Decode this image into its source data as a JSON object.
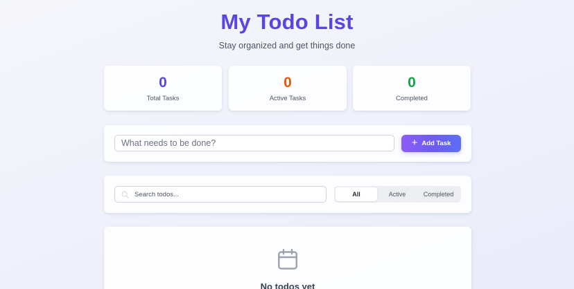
{
  "header": {
    "title": "My Todo List",
    "subtitle": "Stay organized and get things done"
  },
  "stats": [
    {
      "value": "0",
      "label": "Total Tasks",
      "color": "#5b45e0"
    },
    {
      "value": "0",
      "label": "Active Tasks",
      "color": "#ea580c"
    },
    {
      "value": "0",
      "label": "Completed",
      "color": "#16a34a"
    }
  ],
  "add_task": {
    "placeholder": "What needs to be done?",
    "value": "",
    "button_label": "Add Task",
    "button_icon": "plus-icon"
  },
  "filter": {
    "search_placeholder": "Search todos...",
    "search_icon": "search-icon",
    "options": [
      "All",
      "Active",
      "Completed"
    ],
    "selected": "All"
  },
  "empty_state": {
    "icon": "calendar-icon",
    "title": "No todos yet"
  },
  "colors": {
    "accent": "#5b45e0",
    "button_gradient_start": "#8b5cf6",
    "button_gradient_end": "#5b6ff2"
  }
}
